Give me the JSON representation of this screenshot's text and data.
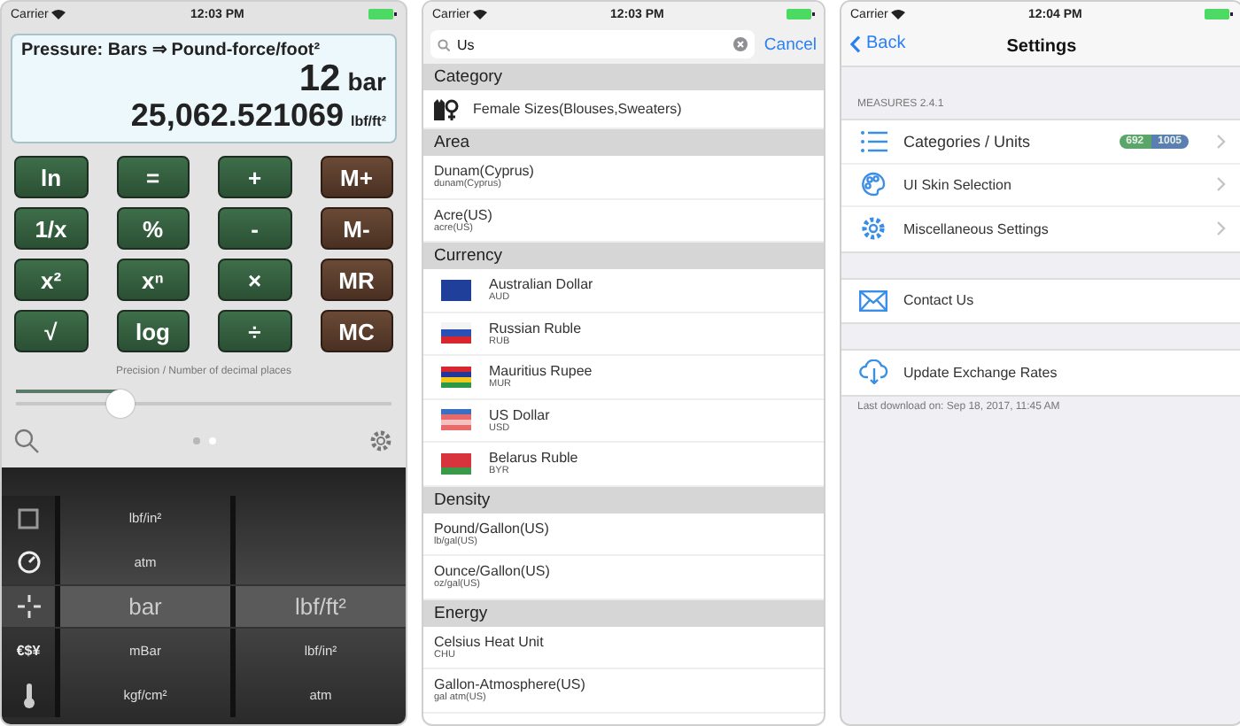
{
  "screens": [
    {
      "kind": "converter",
      "status": {
        "carrier": "Carrier",
        "time": "12:03 PM"
      },
      "display": {
        "title": "Pressure: Bars ⇒ Pound-force/foot²",
        "input_value": "12",
        "input_unit": "bar",
        "result_value": "25,062.521069",
        "result_unit": "lbf/ft²"
      },
      "keys": [
        {
          "label": "ln",
          "kind": "function"
        },
        {
          "label": "=",
          "kind": "function"
        },
        {
          "label": "+",
          "kind": "function"
        },
        {
          "label": "M+",
          "kind": "memory"
        },
        {
          "label": "1/x",
          "kind": "function"
        },
        {
          "label": "%",
          "kind": "function"
        },
        {
          "label": "-",
          "kind": "function"
        },
        {
          "label": "M-",
          "kind": "memory"
        },
        {
          "label": "x²",
          "kind": "function"
        },
        {
          "label": "xⁿ",
          "kind": "function"
        },
        {
          "label": "×",
          "kind": "function"
        },
        {
          "label": "MR",
          "kind": "memory"
        },
        {
          "label": "√",
          "kind": "function"
        },
        {
          "label": "log",
          "kind": "function"
        },
        {
          "label": "÷",
          "kind": "function"
        },
        {
          "label": "MC",
          "kind": "memory"
        }
      ],
      "precision": {
        "label": "Precision / Number of decimal places",
        "level": 0.28
      },
      "pages": [
        {
          "selected": false
        },
        {
          "selected": true
        }
      ],
      "picker": [
        {
          "from": "lbf/in²",
          "selected": false
        },
        {
          "from": "atm",
          "selected": false
        },
        {
          "from": "bar",
          "to": "lbf/ft²",
          "selected": true
        },
        {
          "from": "mBar",
          "to": "lbf/in²",
          "category_text": "€$¥",
          "selected": false
        },
        {
          "from": "kgf/cm²",
          "to": "atm",
          "selected": false
        }
      ]
    },
    {
      "kind": "search",
      "status": {
        "carrier": "Carrier",
        "time": "12:03 PM"
      },
      "search": {
        "value": "Us"
      },
      "cancel": "Cancel",
      "sections": [
        {
          "title": "Category",
          "items": [
            {
              "name": "Female Sizes(Blouses,Sweaters)",
              "kind": "category"
            }
          ]
        },
        {
          "title": "Area",
          "items": [
            {
              "name": "Dunam(Cyprus)",
              "code": "dunam(Cyprus)",
              "kind": "unit"
            },
            {
              "name": "Acre(US)",
              "code": "acre(US)",
              "kind": "unit"
            }
          ]
        },
        {
          "title": "Currency",
          "items": [
            {
              "name": "Australian Dollar",
              "code": "AUD",
              "kind": "currency"
            },
            {
              "name": "Russian Ruble",
              "code": "RUB",
              "kind": "currency"
            },
            {
              "name": "Mauritius Rupee",
              "code": "MUR",
              "kind": "currency"
            },
            {
              "name": "US Dollar",
              "code": "USD",
              "kind": "currency"
            },
            {
              "name": "Belarus Ruble",
              "code": "BYR",
              "kind": "currency"
            }
          ]
        },
        {
          "title": "Density",
          "items": [
            {
              "name": "Pound/Gallon(US)",
              "code": "lb/gal(US)",
              "kind": "unit"
            },
            {
              "name": "Ounce/Gallon(US)",
              "code": "oz/gal(US)",
              "kind": "unit"
            }
          ]
        },
        {
          "title": "Energy",
          "items": [
            {
              "name": "Celsius Heat Unit",
              "code": "CHU",
              "kind": "unit"
            },
            {
              "name": "Gallon-Atmosphere(US)",
              "code": "gal atm(US)",
              "kind": "unit"
            }
          ]
        }
      ]
    },
    {
      "kind": "settings",
      "status": {
        "carrier": "Carrier",
        "time": "12:04 PM"
      },
      "back": "Back",
      "title": "Settings",
      "section_header": "MEASURES 2.4.1",
      "groups": [
        [
          {
            "label": "Categories / Units",
            "badges": [
              {
                "text": "692",
                "color": "#5aa56a"
              },
              {
                "text": "1005",
                "color": "#5a7fb0"
              }
            ],
            "chevron": true
          },
          {
            "label": "UI Skin Selection",
            "chevron": true
          },
          {
            "label": "Miscellaneous Settings",
            "chevron": true
          }
        ],
        [
          {
            "label": "Contact Us",
            "chevron": false
          }
        ],
        [
          {
            "label": "Update Exchange Rates",
            "chevron": false
          }
        ]
      ],
      "footer": "Last download on: Sep 18, 2017, 11:45 AM"
    }
  ]
}
